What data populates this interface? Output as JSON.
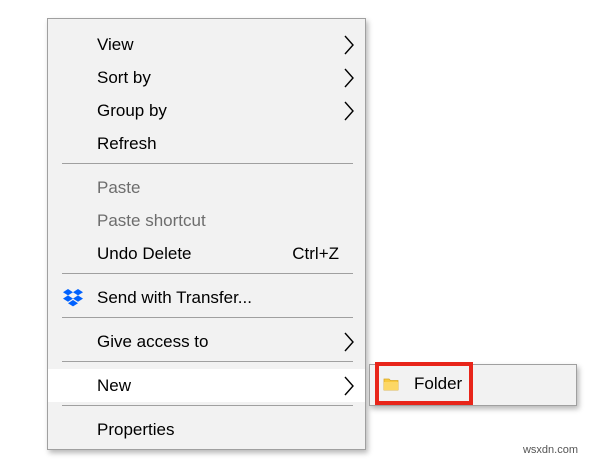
{
  "context_menu": {
    "items": [
      {
        "label": "View",
        "has_submenu": true
      },
      {
        "label": "Sort by",
        "has_submenu": true
      },
      {
        "label": "Group by",
        "has_submenu": true
      },
      {
        "label": "Refresh"
      },
      {
        "label": "Paste",
        "disabled": true
      },
      {
        "label": "Paste shortcut",
        "disabled": true
      },
      {
        "label": "Undo Delete",
        "shortcut": "Ctrl+Z"
      },
      {
        "label": "Send with Transfer...",
        "icon": "dropbox-icon"
      },
      {
        "label": "Give access to",
        "has_submenu": true
      },
      {
        "label": "New",
        "has_submenu": true,
        "highlighted": true
      },
      {
        "label": "Properties"
      }
    ]
  },
  "submenu_new": {
    "items": [
      {
        "label": "Folder",
        "icon": "folder-icon"
      }
    ]
  },
  "annotation": {
    "highlight_color": "#e8251a"
  },
  "colors": {
    "dropbox_blue": "#0061fe",
    "folder_yellow": "#f8c93e",
    "disabled_text": "#6d6d6d"
  },
  "watermark": "wsxdn.com"
}
